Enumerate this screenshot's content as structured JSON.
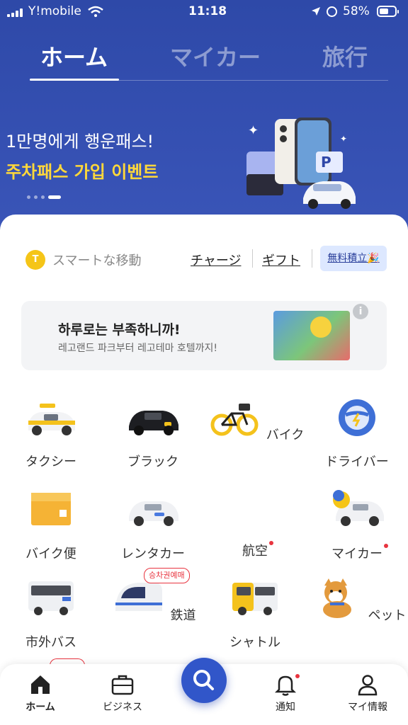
{
  "status": {
    "carrier": "Y!mobile",
    "time": "11:18",
    "battery": "58%"
  },
  "tabs": [
    {
      "label": "ホーム"
    },
    {
      "label": "マイカー"
    },
    {
      "label": "旅行"
    }
  ],
  "banner": {
    "line1": "1만명에게 행운패스!",
    "line2": "주차패스 가입 이벤트",
    "p_mark": "P"
  },
  "points": {
    "coin": "T",
    "label": "スマートな移動",
    "charge": "チャージ",
    "gift": "ギフト",
    "free": "無料積立🎉"
  },
  "ad": {
    "title": "하루로는 부족하니까!",
    "subtitle": "레고랜드 파크부터 레고테마 호텔까지!",
    "info": "i"
  },
  "services": [
    {
      "label": "タクシー"
    },
    {
      "label": "ブラック"
    },
    {
      "label": "バイク"
    },
    {
      "label": "ドライバー"
    },
    {
      "label": "バイク便"
    },
    {
      "label": "レンタカー"
    },
    {
      "label": "航空"
    },
    {
      "label": "マイカー"
    },
    {
      "label": "市外バス"
    },
    {
      "label": "鉄道"
    },
    {
      "label": "シャトル"
    },
    {
      "label": "ペット"
    }
  ],
  "badges": {
    "rail": "승차권예매"
  },
  "nav": {
    "home": "ホーム",
    "business": "ビジネス",
    "notify": "通知",
    "mypage": "マイ情報"
  },
  "colors": {
    "brand_blue": "#2f47a8",
    "accent_yellow": "#ffd83a",
    "notification_red": "#e8343f"
  }
}
